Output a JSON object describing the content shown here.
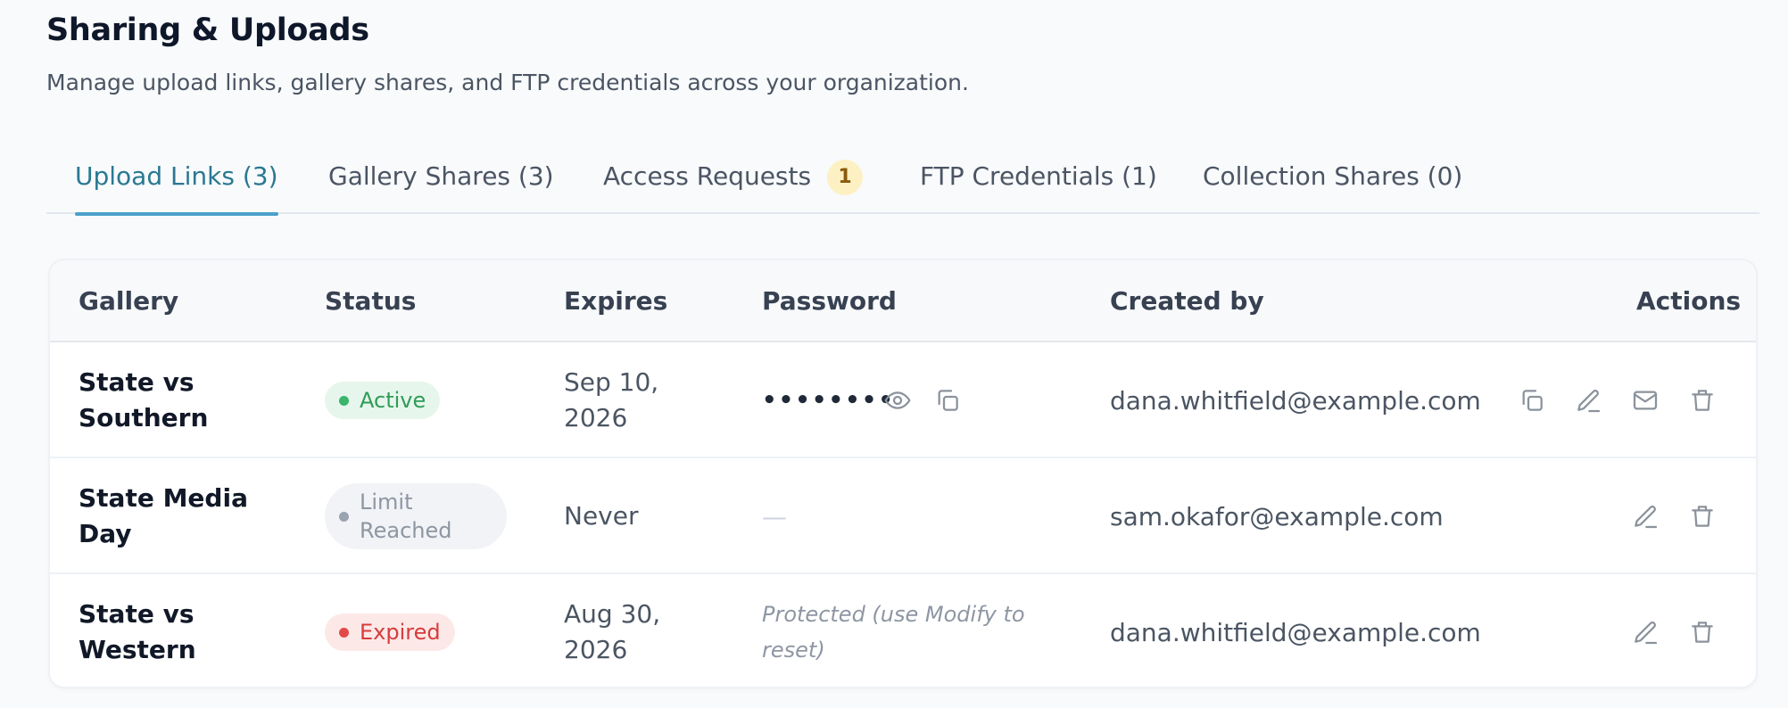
{
  "page": {
    "title": "Sharing & Uploads",
    "subtitle": "Manage upload links, gallery shares, and FTP credentials across your organization."
  },
  "tabs": [
    {
      "label": "Upload Links (3)",
      "active": true
    },
    {
      "label": "Gallery Shares (3)",
      "active": false
    },
    {
      "label": "Access Requests",
      "badge": "1",
      "active": false
    },
    {
      "label": "FTP Credentials (1)",
      "active": false
    },
    {
      "label": "Collection Shares (0)",
      "active": false
    }
  ],
  "table": {
    "headers": {
      "gallery": "Gallery",
      "status": "Status",
      "expires": "Expires",
      "password": "Password",
      "created_by": "Created by",
      "actions": "Actions"
    },
    "rows": [
      {
        "gallery": "State vs Southern",
        "status": "Active",
        "expires": "Sep 10, 2026",
        "password": "••••••••",
        "created_by": "dana.whitfield@example.com"
      },
      {
        "gallery": "State Media Day",
        "status": "Limit Reached",
        "expires": "Never",
        "password": "—",
        "created_by": "sam.okafor@example.com"
      },
      {
        "gallery": "State vs Western",
        "status": "Expired",
        "expires": "Aug 30, 2026",
        "password": "Protected (use Modify to reset)",
        "created_by": "dana.whitfield@example.com"
      }
    ]
  },
  "icons": {
    "show_password": "eye-icon",
    "copy": "copy-icon",
    "edit": "pencil-icon",
    "email": "mail-icon",
    "delete": "trash-icon"
  },
  "colors": {
    "accent": "#2a7891",
    "tab_underline": "#4ba0c9",
    "active_status": "#2f9c58",
    "expired_status": "#d63c3c",
    "limit_status": "#8e96a3",
    "badge_bg": "#fdf1c4"
  }
}
